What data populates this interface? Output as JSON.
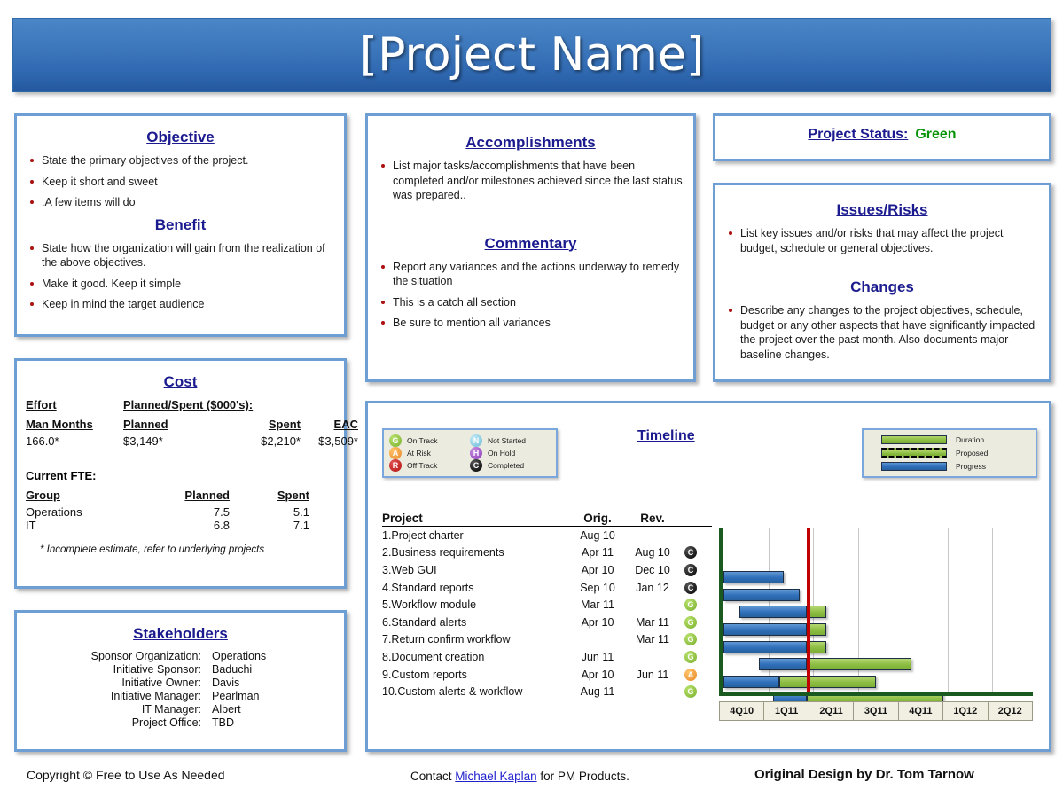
{
  "header": {
    "title": "[Project Name]"
  },
  "objective": {
    "heading": "Objective",
    "items": [
      "State the primary objectives of the project.",
      "Keep it short and sweet",
      ".A few items will do"
    ],
    "benefit_heading": "Benefit",
    "benefit_items": [
      "State how the organization will gain from the realization of the above objectives.",
      "Make it good. Keep it simple",
      "Keep in mind the target audience"
    ]
  },
  "cost": {
    "heading": "Cost",
    "effort_label": "Effort",
    "planned_spent_label": "Planned/Spent ($000's):",
    "columns": [
      "Man Months",
      "Planned",
      "Spent",
      "EAC"
    ],
    "values": [
      "166.0*",
      "$3,149*",
      "$2,210*",
      "$3,509*"
    ],
    "fte_heading": "Current FTE:",
    "fte_columns": [
      "Group",
      "Planned",
      "Spent"
    ],
    "fte_rows": [
      {
        "group": "Operations",
        "planned": "7.5",
        "spent": "5.1"
      },
      {
        "group": "IT",
        "planned": "6.8",
        "spent": "7.1"
      }
    ],
    "note": "* Incomplete estimate, refer to underlying projects"
  },
  "stakeholders": {
    "heading": "Stakeholders",
    "rows": [
      {
        "label": "Sponsor Organization:",
        "value": "Operations"
      },
      {
        "label": "Initiative Sponsor:",
        "value": "Baduchi"
      },
      {
        "label": "Initiative Owner:",
        "value": "Davis"
      },
      {
        "label": "Initiative Manager:",
        "value": "Pearlman"
      },
      {
        "label": "IT Manager:",
        "value": "Albert"
      },
      {
        "label": "Project Office:",
        "value": "TBD"
      }
    ]
  },
  "accomplishments": {
    "heading": "Accomplishments",
    "items": [
      "List major tasks/accomplishments that have been completed and/or milestones achieved since the last status was prepared.."
    ],
    "commentary_heading": "Commentary",
    "commentary_items": [
      "Report any variances and the actions underway to remedy the situation",
      "This is a catch all section",
      "Be sure to mention all variances"
    ]
  },
  "status": {
    "label": "Project Status:",
    "value": "Green",
    "color": "#069306"
  },
  "issues": {
    "heading": "Issues/Risks",
    "items": [
      "List key issues and/or risks that may affect the project budget, schedule or general objectives."
    ],
    "changes_heading": "Changes",
    "changes_items": [
      "Describe any changes to the project objectives, schedule, budget or any other aspects that have significantly impacted the project over the past month. Also documents major baseline changes."
    ]
  },
  "timeline": {
    "heading": "Timeline",
    "status_legend": [
      {
        "code": "G",
        "label": "On Track",
        "color": "#8cbd42"
      },
      {
        "code": "A",
        "label": "At Risk",
        "color": "#e8892a"
      },
      {
        "code": "R",
        "label": "Off Track",
        "color": "#b41515"
      },
      {
        "code": "N",
        "label": "Not Started",
        "color": "#6cbcd8"
      },
      {
        "code": "H",
        "label": "On Hold",
        "color": "#8c3bbd"
      },
      {
        "code": "C",
        "label": "Completed",
        "color": "#000000"
      }
    ],
    "bar_legend": [
      {
        "key": "duration",
        "label": "Duration"
      },
      {
        "key": "proposed",
        "label": "Proposed"
      },
      {
        "key": "progress",
        "label": "Progress"
      }
    ],
    "table_headers": {
      "project": "Project",
      "orig": "Orig.",
      "rev": "Rev."
    }
  },
  "chart_data": {
    "type": "bar",
    "title": "Timeline",
    "xlabel": "",
    "ylabel": "",
    "categories": [
      "1.Project charter",
      "2.Business requirements",
      "3.Web GUI",
      "4.Standard reports",
      "5.Workflow module",
      "6.Standard alerts",
      "7.Return confirm workflow",
      "8.Document creation",
      "9.Custom reports",
      "10.Custom alerts & workflow"
    ],
    "axis_ticks": [
      "4Q10",
      "1Q11",
      "2Q11",
      "3Q11",
      "4Q11",
      "1Q12",
      "2Q12"
    ],
    "axis_range": [
      "4Q10",
      "2Q12"
    ],
    "today_marker_quarter": "1Q11",
    "grid": true,
    "legend_position": "top-right",
    "rows": [
      {
        "project": "1.Project charter",
        "orig": "Aug 10",
        "rev": "",
        "status": "",
        "progress_start_q": null,
        "progress_end_q": null,
        "duration_start_q": null,
        "duration_end_q": null
      },
      {
        "project": "2.Business requirements",
        "orig": "Apr 11",
        "rev": "Aug 10",
        "status": "C",
        "progress_start_q": null,
        "progress_end_q": null,
        "duration_start_q": null,
        "duration_end_q": null
      },
      {
        "project": "3.Web GUI",
        "orig": "Apr 10",
        "rev": "Dec 10",
        "status": "C",
        "progress_start_q": 0.0,
        "progress_end_q": 1.35,
        "duration_start_q": null,
        "duration_end_q": null
      },
      {
        "project": "4.Standard reports",
        "orig": "Sep 10",
        "rev": "Jan 12",
        "status": "C",
        "progress_start_q": 0.0,
        "progress_end_q": 1.7,
        "duration_start_q": null,
        "duration_end_q": null
      },
      {
        "project": "5.Workflow module",
        "orig": "Mar 11",
        "rev": "",
        "status": "G",
        "progress_start_q": 0.35,
        "progress_end_q": 1.85,
        "duration_start_q": 1.85,
        "duration_end_q": 2.3
      },
      {
        "project": "6.Standard alerts",
        "orig": "Apr 10",
        "rev": "Mar 11",
        "status": "G",
        "progress_start_q": 0.0,
        "progress_end_q": 1.85,
        "duration_start_q": 1.85,
        "duration_end_q": 2.3
      },
      {
        "project": "7.Return confirm workflow",
        "orig": "",
        "rev": "Mar 11",
        "status": "G",
        "progress_start_q": 0.0,
        "progress_end_q": 1.85,
        "duration_start_q": 1.85,
        "duration_end_q": 2.3
      },
      {
        "project": "8.Document creation",
        "orig": "Jun 11",
        "rev": "",
        "status": "G",
        "progress_start_q": 0.8,
        "progress_end_q": 1.85,
        "duration_start_q": 1.85,
        "duration_end_q": 4.2
      },
      {
        "project": "9.Custom reports",
        "orig": "Apr 10",
        "rev": "Jun 11",
        "status": "A",
        "progress_start_q": 0.0,
        "progress_end_q": 1.25,
        "duration_start_q": 1.25,
        "duration_end_q": 3.4
      },
      {
        "project": "10.Custom alerts & workflow",
        "orig": "Aug 11",
        "rev": "",
        "status": "G",
        "progress_start_q": 1.1,
        "progress_end_q": 1.85,
        "duration_start_q": 1.85,
        "duration_end_q": 4.9
      }
    ]
  },
  "footer": {
    "left": "Copyright © Free to Use As Needed",
    "mid_prefix": "Contact ",
    "mid_link": "Michael Kaplan",
    "mid_suffix": " for PM Products.",
    "right": "Original Design by Dr. Tom Tarnow"
  }
}
